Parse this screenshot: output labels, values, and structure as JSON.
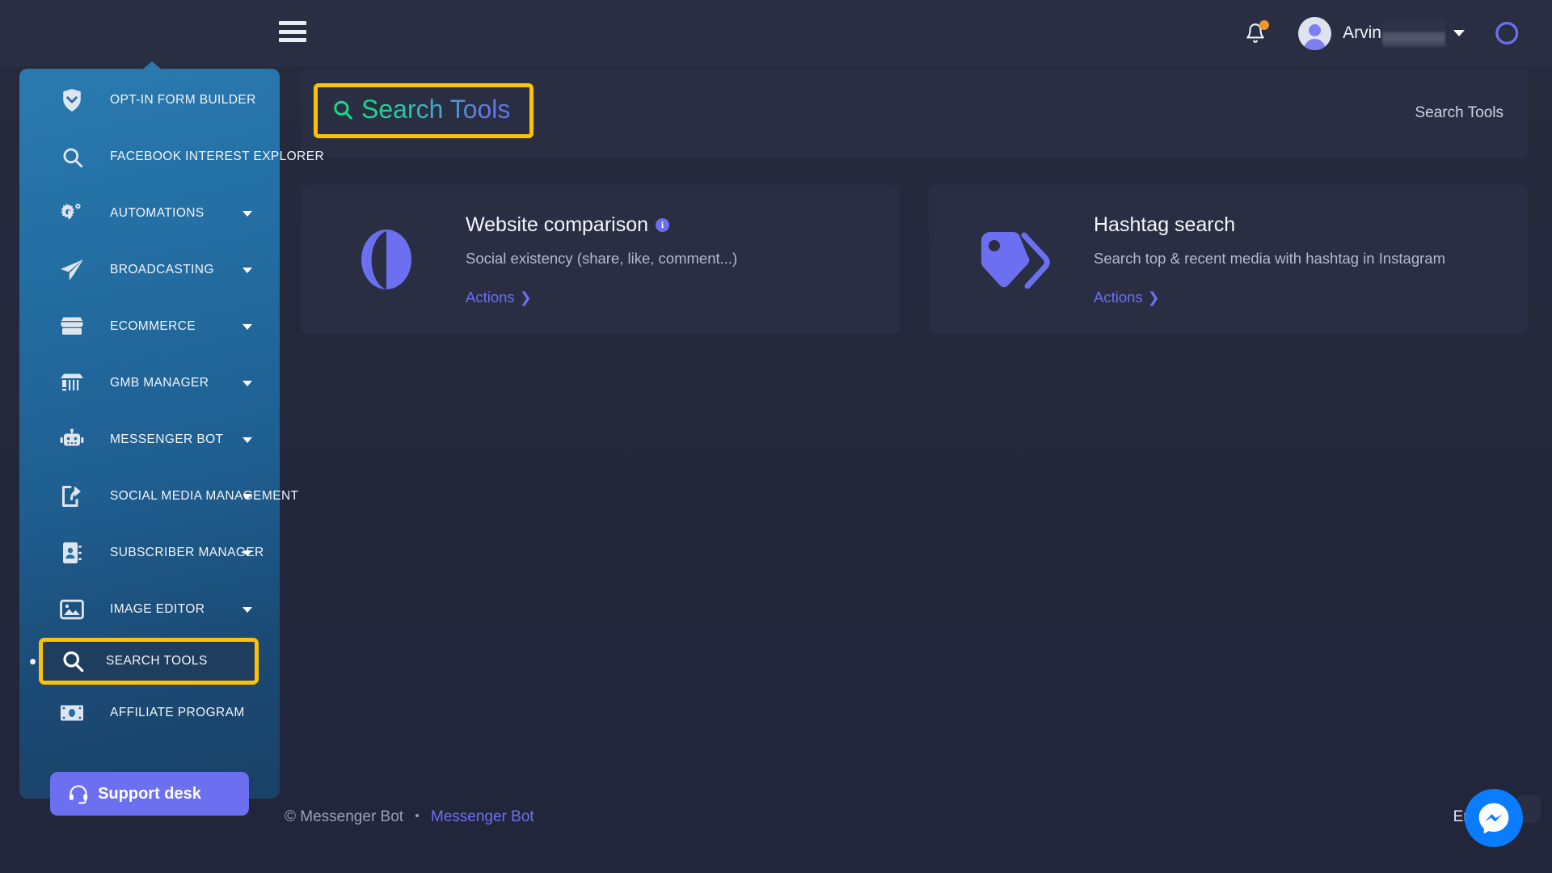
{
  "topbar": {
    "menu_icon": "hamburger-icon",
    "notification_icon": "bell-icon",
    "notification_dot": true,
    "username": "Arvin",
    "dropdown_icon": "chevron-down-icon",
    "brand_toggle_icon": "toggle-circles-icon"
  },
  "sidebar": {
    "items": [
      {
        "label": "OPT-IN FORM BUILDER",
        "icon": "shield-chevron-icon",
        "caret": false
      },
      {
        "label": "FACEBOOK INTEREST EXPLORER",
        "icon": "search-icon",
        "caret": false
      },
      {
        "label": "AUTOMATIONS",
        "icon": "gears-icon",
        "caret": true
      },
      {
        "label": "BROADCASTING",
        "icon": "paper-plane-icon",
        "caret": true
      },
      {
        "label": "ECOMMERCE",
        "icon": "storefront-icon",
        "caret": true
      },
      {
        "label": "GMB MANAGER",
        "icon": "shop-icon",
        "caret": true
      },
      {
        "label": "MESSENGER BOT",
        "icon": "robot-icon",
        "caret": true
      },
      {
        "label": "SOCIAL MEDIA MANAGEMENT",
        "icon": "share-square-icon",
        "caret": true
      },
      {
        "label": "SUBSCRIBER MANAGER",
        "icon": "address-book-icon",
        "caret": true
      },
      {
        "label": "IMAGE EDITOR",
        "icon": "image-icon",
        "caret": true
      },
      {
        "label": "SEARCH TOOLS",
        "icon": "search-icon",
        "caret": false,
        "highlighted": true,
        "active": true
      },
      {
        "label": "AFFILIATE PROGRAM",
        "icon": "money-bill-icon",
        "caret": false
      }
    ],
    "support_button": {
      "label": "Support desk",
      "icon": "headset-icon"
    }
  },
  "page": {
    "title": "Search Tools",
    "title_icon": "search-icon",
    "breadcrumb": "Search Tools"
  },
  "cards": [
    {
      "title": "Website comparison",
      "has_info": true,
      "info_glyph": "i",
      "description": "Social existency (share, like, comment...)",
      "action_label": "Actions",
      "action_icon": "chevron-right-icon",
      "icon": "half-circle-contrast-icon"
    },
    {
      "title": "Hashtag search",
      "has_info": false,
      "info_glyph": "",
      "description": "Search top & recent media with hashtag in Instagram",
      "action_label": "Actions",
      "action_icon": "chevron-right-icon",
      "icon": "tags-icon"
    }
  ],
  "footer": {
    "copyright": "© Messenger Bot",
    "separator": "•",
    "brand_link": "Messenger Bot",
    "language": "English"
  },
  "chat_widget": {
    "icon": "messenger-icon"
  },
  "colors": {
    "background": "#23273a",
    "panel": "#2a2e42",
    "sidebar_top": "#2a7ab0",
    "sidebar_bottom": "#1a4166",
    "accent_purple": "#6c6ff0",
    "highlight_yellow": "#ffc107",
    "title_gradient_start": "#19d88a",
    "title_gradient_end": "#6272e8",
    "notification_orange": "#f0962b",
    "messenger_blue": "#0a7cff"
  }
}
